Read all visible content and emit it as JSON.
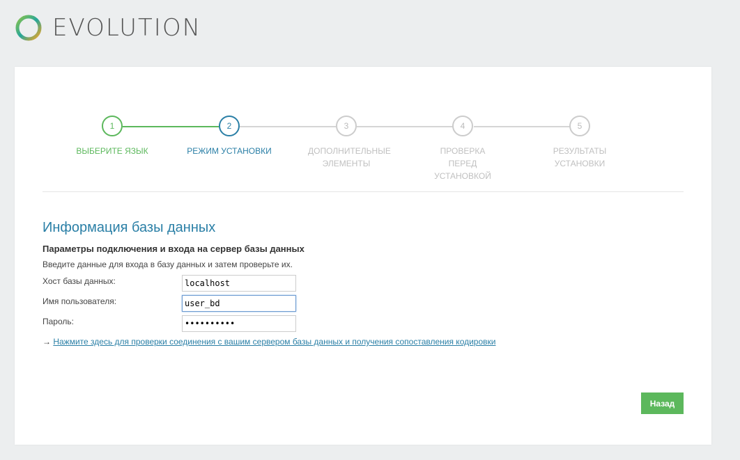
{
  "brand": {
    "name": "EVOLUTION"
  },
  "colors": {
    "accent": "#2a7fa6",
    "done": "#5cb85c",
    "inactive": "#cccccc"
  },
  "steps": [
    {
      "number": "1",
      "label": "ВЫБЕРИТЕ ЯЗЫК",
      "state": "done"
    },
    {
      "number": "2",
      "label": "РЕЖИМ УСТАНОВКИ",
      "state": "active"
    },
    {
      "number": "3",
      "label": "ДОПОЛНИТЕЛЬНЫЕ ЭЛЕМЕНТЫ",
      "state": "pending"
    },
    {
      "number": "4",
      "label": "ПРОВЕРКА ПЕРЕД УСТАНОВКОЙ",
      "state": "pending"
    },
    {
      "number": "5",
      "label": "РЕЗУЛЬТАТЫ УСТАНОВКИ",
      "state": "pending"
    }
  ],
  "section": {
    "title": "Информация базы данных",
    "subtitle": "Параметры подключения и входа на сервер базы данных",
    "description": "Введите данные для входа в базу данных и затем проверьте их."
  },
  "form": {
    "host": {
      "label": "Хост базы данных:",
      "value": "localhost"
    },
    "user": {
      "label": "Имя пользователя:",
      "value": "user_bd"
    },
    "password": {
      "label": "Пароль:",
      "value": "••••••••••"
    }
  },
  "test_link": {
    "arrow": "→",
    "text": "Нажмите здесь для проверки соединения с вашим сервером базы данных и получения сопоставления кодировки"
  },
  "buttons": {
    "back": "Назад"
  }
}
